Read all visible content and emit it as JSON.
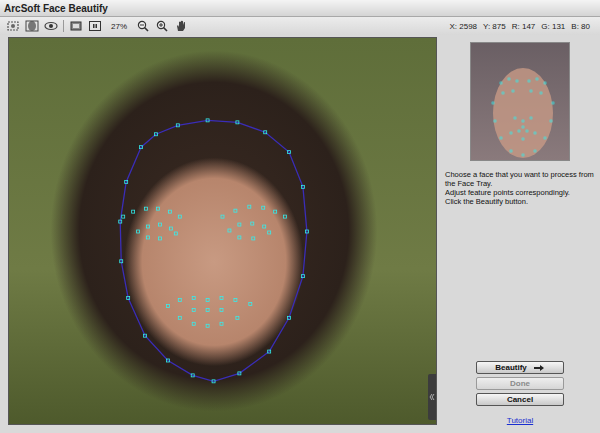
{
  "window": {
    "title": "ArcSoft Face Beautify"
  },
  "toolbar": {
    "zoom": "27%",
    "status": [
      {
        "label": "X:",
        "value": "2598"
      },
      {
        "label": "Y:",
        "value": "875"
      },
      {
        "label": "R:",
        "value": "147"
      },
      {
        "label": "G:",
        "value": "131"
      },
      {
        "label": "B:",
        "value": "80"
      }
    ]
  },
  "instructions": [
    "Choose a face that you want to process from the Face Tray.",
    "Adjust feature points correspondingly.",
    "Click the Beautify button."
  ],
  "buttons": [
    {
      "label": "Beautify",
      "disabled": false,
      "kind": "arrow"
    },
    {
      "label": "Done",
      "disabled": true,
      "kind": "plain"
    },
    {
      "label": "Cancel",
      "disabled": false,
      "kind": "plain"
    }
  ],
  "link": "Tutorial"
}
